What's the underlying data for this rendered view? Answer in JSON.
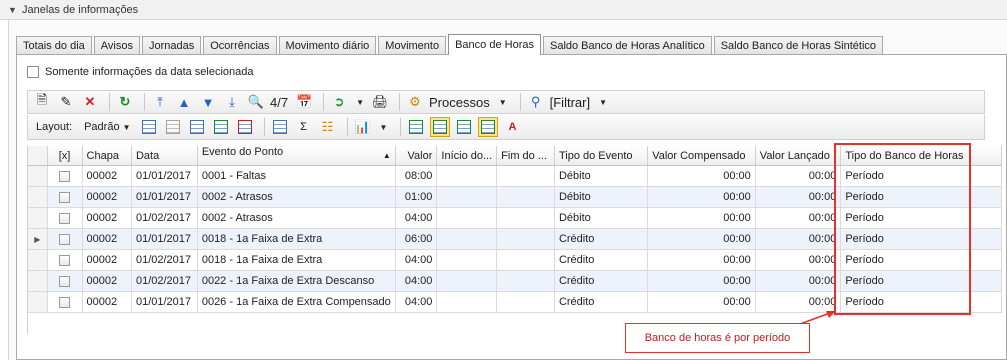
{
  "group": {
    "title": "Janelas de informações"
  },
  "tabs": [
    {
      "label": "Totais do dia",
      "active": false
    },
    {
      "label": "Avisos",
      "active": false
    },
    {
      "label": "Jornadas",
      "active": false
    },
    {
      "label": "Ocorrências",
      "active": false
    },
    {
      "label": "Movimento diário",
      "active": false
    },
    {
      "label": "Movimento",
      "active": false
    },
    {
      "label": "Banco de Horas",
      "active": true
    },
    {
      "label": "Saldo Banco de Horas Analítico",
      "active": false
    },
    {
      "label": "Saldo Banco de Horas Sintético",
      "active": false
    }
  ],
  "filter_checkbox": {
    "label": "Somente informações da data selecionada",
    "checked": false
  },
  "toolbar": {
    "record_counter": "4/7",
    "processos_label": "Processos",
    "filtrar_label": "[Filtrar]"
  },
  "layout_bar": {
    "label": "Layout:",
    "selected": "Padrão"
  },
  "grid": {
    "columns": [
      "",
      "[x]",
      "Chapa",
      "Data",
      "Evento do Ponto",
      "Valor",
      "Início do...",
      "Fim do ...",
      "Tipo do Evento",
      "Valor Compensado",
      "Valor Lançado",
      "Tipo do Banco de Horas"
    ],
    "sort_column": "Evento do Ponto",
    "sort_direction": "ascending",
    "focused_row": 3,
    "rows": [
      {
        "chapa": "00002",
        "data": "01/01/2017",
        "evento": "0001 - Faltas",
        "valor": "08:00",
        "inicio": "",
        "fim": "",
        "tipo_evento": "Débito",
        "compensado": "00:00",
        "lancado": "00:00",
        "tipo_banco": "Período"
      },
      {
        "chapa": "00002",
        "data": "01/01/2017",
        "evento": "0002 - Atrasos",
        "valor": "01:00",
        "inicio": "",
        "fim": "",
        "tipo_evento": "Débito",
        "compensado": "00:00",
        "lancado": "00:00",
        "tipo_banco": "Período"
      },
      {
        "chapa": "00002",
        "data": "01/02/2017",
        "evento": "0002 - Atrasos",
        "valor": "04:00",
        "inicio": "",
        "fim": "",
        "tipo_evento": "Débito",
        "compensado": "00:00",
        "lancado": "00:00",
        "tipo_banco": "Período"
      },
      {
        "chapa": "00002",
        "data": "01/01/2017",
        "evento": "0018 - 1a Faixa de Extra",
        "valor": "06:00",
        "inicio": "",
        "fim": "",
        "tipo_evento": "Crédito",
        "compensado": "00:00",
        "lancado": "00:00",
        "tipo_banco": "Período"
      },
      {
        "chapa": "00002",
        "data": "01/02/2017",
        "evento": "0018 - 1a Faixa de Extra",
        "valor": "04:00",
        "inicio": "",
        "fim": "",
        "tipo_evento": "Crédito",
        "compensado": "00:00",
        "lancado": "00:00",
        "tipo_banco": "Período"
      },
      {
        "chapa": "00002",
        "data": "01/02/2017",
        "evento": "0022 - 1a Faixa de Extra Descanso",
        "valor": "04:00",
        "inicio": "",
        "fim": "",
        "tipo_evento": "Crédito",
        "compensado": "00:00",
        "lancado": "00:00",
        "tipo_banco": "Período"
      },
      {
        "chapa": "00002",
        "data": "01/01/2017",
        "evento": "0026 - 1a Faixa de Extra Compensado",
        "valor": "04:00",
        "inicio": "",
        "fim": "",
        "tipo_evento": "Crédito",
        "compensado": "00:00",
        "lancado": "00:00",
        "tipo_banco": "Período"
      }
    ]
  },
  "annotation": {
    "text": "Banco de horas é por período",
    "color": "#e8302a"
  }
}
